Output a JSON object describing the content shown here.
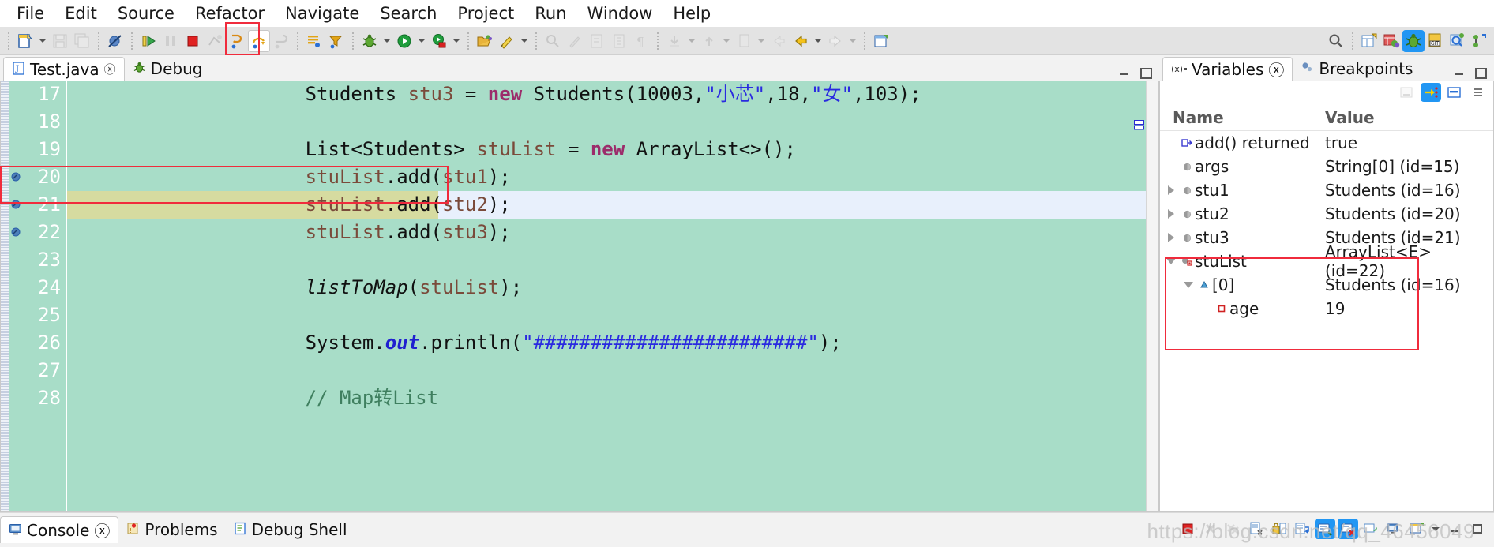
{
  "menu": {
    "items": [
      {
        "label": "File",
        "mnemonic": "F"
      },
      {
        "label": "Edit",
        "mnemonic": "E"
      },
      {
        "label": "Source",
        "mnemonic": "S"
      },
      {
        "label": "Refactor",
        "mnemonic": "t"
      },
      {
        "label": "Navigate",
        "mnemonic": "N"
      },
      {
        "label": "Search",
        "mnemonic": "S"
      },
      {
        "label": "Project",
        "mnemonic": "P"
      },
      {
        "label": "Run",
        "mnemonic": "R"
      },
      {
        "label": "Window",
        "mnemonic": "W"
      },
      {
        "label": "Help",
        "mnemonic": "H"
      }
    ]
  },
  "toolbar": {
    "buttons": [
      {
        "name": "new-wizard",
        "icon": "new-file-icon"
      },
      {
        "name": "save",
        "icon": "save-icon"
      },
      {
        "name": "save-all",
        "icon": "save-all-icon"
      },
      {
        "name": "skip-breakpoints",
        "icon": "skip-all-breakpoints-icon"
      },
      {
        "name": "resume",
        "icon": "resume-icon"
      },
      {
        "name": "suspend",
        "icon": "suspend-icon"
      },
      {
        "name": "terminate",
        "icon": "terminate-icon"
      },
      {
        "name": "disconnect",
        "icon": "disconnect-icon"
      },
      {
        "name": "step-into",
        "icon": "step-into-icon"
      },
      {
        "name": "step-over",
        "icon": "step-over-icon"
      },
      {
        "name": "step-return",
        "icon": "step-return-icon"
      },
      {
        "name": "drop-to-frame",
        "icon": "drop-to-frame-icon"
      },
      {
        "name": "use-step-filters",
        "icon": "step-filters-icon"
      },
      {
        "name": "debug",
        "icon": "debug-bug-icon"
      },
      {
        "name": "run",
        "icon": "run-green-icon"
      },
      {
        "name": "coverage",
        "icon": "coverage-icon"
      },
      {
        "name": "open-type",
        "icon": "open-type-icon"
      },
      {
        "name": "external-tools",
        "icon": "external-tools-icon"
      },
      {
        "name": "new-java-project",
        "icon": "new-java-project-icon"
      }
    ],
    "right_buttons": [
      {
        "name": "search",
        "icon": "search-icon"
      },
      {
        "name": "open-perspective",
        "icon": "open-perspective-icon"
      },
      {
        "name": "java-perspective",
        "icon": "java-perspective-icon"
      },
      {
        "name": "debug-perspective",
        "icon": "debug-perspective-icon",
        "selected": true
      },
      {
        "name": "git-perspective",
        "icon": "git-perspective-icon"
      },
      {
        "name": "java-browsing-perspective",
        "icon": "java-browsing-icon"
      },
      {
        "name": "team-sync-perspective",
        "icon": "team-sync-icon"
      }
    ]
  },
  "editor": {
    "tabs": [
      {
        "label": "Test.java",
        "icon": "java-file-icon",
        "active": true,
        "closeable": true
      },
      {
        "label": "Debug",
        "icon": "debug-bug-icon",
        "active": false,
        "closeable": false
      }
    ],
    "controls": {
      "minimize": "minimize-icon",
      "maximize": "maximize-icon"
    },
    "current_line": 21,
    "lines": [
      {
        "num": "17",
        "indent": 0,
        "breakpoint": false,
        "tokens": [
          {
            "t": "        Students ",
            "c": "plain"
          },
          {
            "t": "stu3",
            "c": "lv"
          },
          {
            "t": " = ",
            "c": "plain"
          },
          {
            "t": "new",
            "c": "k"
          },
          {
            "t": " Students(10003,",
            "c": "plain"
          },
          {
            "t": "\"小芯\"",
            "c": "s"
          },
          {
            "t": ",18,",
            "c": "plain"
          },
          {
            "t": "\"女\"",
            "c": "s"
          },
          {
            "t": ",103);",
            "c": "plain"
          }
        ]
      },
      {
        "num": "18",
        "indent": 0,
        "breakpoint": false,
        "tokens": []
      },
      {
        "num": "19",
        "indent": 0,
        "breakpoint": false,
        "tokens": [
          {
            "t": "        List<Students> ",
            "c": "plain"
          },
          {
            "t": "stuList",
            "c": "lv"
          },
          {
            "t": " = ",
            "c": "plain"
          },
          {
            "t": "new",
            "c": "k"
          },
          {
            "t": " ArrayList<>();",
            "c": "plain"
          }
        ]
      },
      {
        "num": "20",
        "indent": 0,
        "breakpoint": true,
        "tokens": [
          {
            "t": "        ",
            "c": "plain"
          },
          {
            "t": "stuList",
            "c": "lv"
          },
          {
            "t": ".add(",
            "c": "plain"
          },
          {
            "t": "stu1",
            "c": "lv"
          },
          {
            "t": ");",
            "c": "plain"
          }
        ]
      },
      {
        "num": "21",
        "indent": 0,
        "breakpoint": true,
        "current": true,
        "tokens": [
          {
            "t": "        ",
            "c": "plain"
          },
          {
            "t": "stuList",
            "c": "lv"
          },
          {
            "t": ".add(",
            "c": "plain"
          },
          {
            "t": "stu2",
            "c": "lv"
          },
          {
            "t": ");",
            "c": "plain"
          }
        ]
      },
      {
        "num": "22",
        "indent": 0,
        "breakpoint": true,
        "tokens": [
          {
            "t": "        ",
            "c": "plain"
          },
          {
            "t": "stuList",
            "c": "lv"
          },
          {
            "t": ".add(",
            "c": "plain"
          },
          {
            "t": "stu3",
            "c": "lv"
          },
          {
            "t": ");",
            "c": "plain"
          }
        ]
      },
      {
        "num": "23",
        "indent": 0,
        "breakpoint": false,
        "tokens": []
      },
      {
        "num": "24",
        "indent": 0,
        "breakpoint": false,
        "tokens": [
          {
            "t": "        ",
            "c": "plain"
          },
          {
            "t": "listToMap",
            "c": "mi"
          },
          {
            "t": "(",
            "c": "plain"
          },
          {
            "t": "stuList",
            "c": "lv"
          },
          {
            "t": ");",
            "c": "plain"
          }
        ]
      },
      {
        "num": "25",
        "indent": 0,
        "breakpoint": false,
        "tokens": []
      },
      {
        "num": "26",
        "indent": 0,
        "breakpoint": false,
        "tokens": [
          {
            "t": "        System.",
            "c": "plain"
          },
          {
            "t": "out",
            "c": "fl"
          },
          {
            "t": ".println(",
            "c": "plain"
          },
          {
            "t": "\"########################\"",
            "c": "s"
          },
          {
            "t": ");",
            "c": "plain"
          }
        ]
      },
      {
        "num": "27",
        "indent": 0,
        "breakpoint": false,
        "tokens": []
      },
      {
        "num": "28",
        "indent": 0,
        "breakpoint": false,
        "tokens": [
          {
            "t": "        // Map转List",
            "c": "cm"
          }
        ]
      }
    ]
  },
  "variables": {
    "tabs": [
      {
        "label": "Variables",
        "icon": "variables-icon",
        "active": true,
        "closeable": true
      },
      {
        "label": "Breakpoints",
        "icon": "breakpoints-icon",
        "active": false,
        "closeable": false
      }
    ],
    "toolbar_buttons": [
      {
        "name": "collapse-all",
        "icon": "collapse-all-icon",
        "selected": false
      },
      {
        "name": "show-logical-structure",
        "icon": "logical-structure-icon",
        "selected": true
      },
      {
        "name": "show-detail-pane",
        "icon": "detail-pane-icon",
        "selected": false
      },
      {
        "name": "view-menu",
        "icon": "view-menu-icon",
        "selected": false
      }
    ],
    "columns": [
      "Name",
      "Value"
    ],
    "rows": [
      {
        "depth": 0,
        "twisty": "none",
        "icon": "return-value-icon",
        "name": "add() returned",
        "value": "true"
      },
      {
        "depth": 0,
        "twisty": "none",
        "icon": "object-icon",
        "name": "args",
        "value": "String[0]  (id=15)"
      },
      {
        "depth": 0,
        "twisty": "collapsed",
        "icon": "object-icon",
        "name": "stu1",
        "value": "Students  (id=16)"
      },
      {
        "depth": 0,
        "twisty": "collapsed",
        "icon": "object-icon",
        "name": "stu2",
        "value": "Students  (id=20)"
      },
      {
        "depth": 0,
        "twisty": "collapsed",
        "icon": "object-icon",
        "name": "stu3",
        "value": "Students  (id=21)"
      },
      {
        "depth": 0,
        "twisty": "expanded",
        "icon": "list-icon",
        "name": "stuList",
        "value": "ArrayList<E>  (id=22)"
      },
      {
        "depth": 1,
        "twisty": "expanded",
        "icon": "array-element-icon",
        "name": "[0]",
        "value": "Students  (id=16)"
      },
      {
        "depth": 2,
        "twisty": "none",
        "icon": "field-icon",
        "name": "age",
        "value": "19"
      }
    ]
  },
  "bottom": {
    "tabs": [
      {
        "label": "Console",
        "icon": "console-icon",
        "active": true,
        "closeable": true
      },
      {
        "label": "Problems",
        "icon": "problems-icon",
        "active": false,
        "closeable": false
      },
      {
        "label": "Debug Shell",
        "icon": "debug-shell-icon",
        "active": false,
        "closeable": false
      }
    ],
    "buttons": [
      {
        "name": "terminate",
        "icon": "terminate-red-icon",
        "selected": false
      },
      {
        "name": "remove-launch",
        "icon": "remove-launch-icon",
        "selected": false
      },
      {
        "name": "remove-all-terminated",
        "icon": "remove-all-icon",
        "selected": false
      },
      {
        "name": "clear-console",
        "icon": "clear-console-icon",
        "selected": false
      },
      {
        "name": "lock-scroll",
        "icon": "scroll-lock-icon",
        "selected": false
      },
      {
        "name": "word-wrap",
        "icon": "word-wrap-icon",
        "selected": false
      },
      {
        "name": "show-console-on-output",
        "icon": "show-on-output-icon",
        "selected": true
      },
      {
        "name": "show-console-on-error",
        "icon": "show-on-error-icon",
        "selected": true
      },
      {
        "name": "pin-console",
        "icon": "pin-console-icon",
        "selected": false
      },
      {
        "name": "display-selected-console",
        "icon": "display-console-icon",
        "selected": false
      },
      {
        "name": "open-console",
        "icon": "open-console-icon",
        "selected": false
      },
      {
        "name": "minimize-view",
        "icon": "minimize-icon",
        "selected": false
      },
      {
        "name": "maximize-view",
        "icon": "maximize-icon",
        "selected": false
      }
    ],
    "watermark": "https://blog.csdn.net/qq_46456049"
  },
  "annotations": {
    "highlights": [
      {
        "name": "step-over-toolbar-highlight"
      },
      {
        "name": "current-line-highlight"
      },
      {
        "name": "stulist-variable-highlight"
      }
    ],
    "color": "#f02b3c"
  },
  "colors": {
    "editor_background": "#a8ddc8",
    "current_line_olive": "#d6dba0",
    "current_line_blue": "#e8f0fc",
    "accent_blue": "#2196f3",
    "annotation_red": "#f02b3c",
    "string_blue": "#2a2ae0",
    "keyword_magenta": "#9c2c6b",
    "comment_green": "#3f7f5f"
  }
}
